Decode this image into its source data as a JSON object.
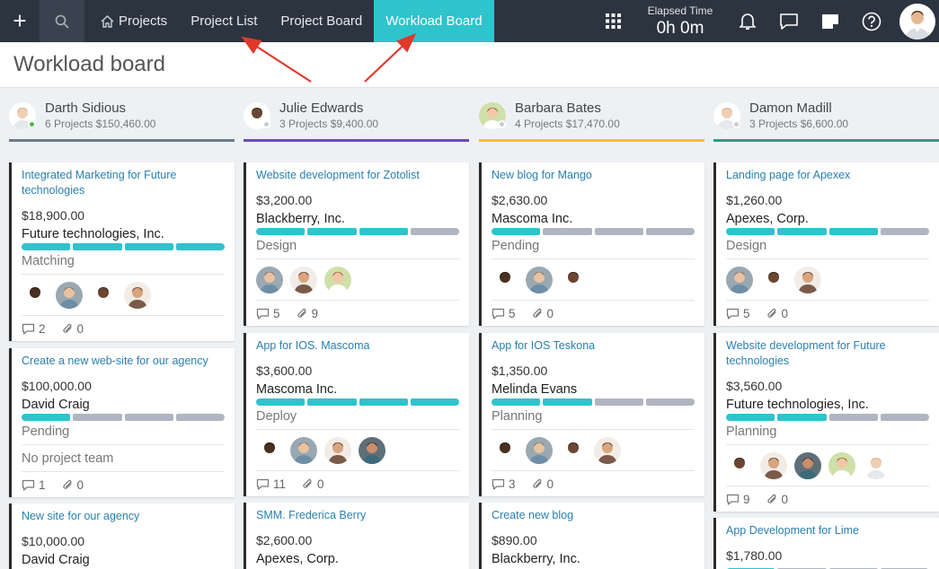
{
  "nav": {
    "items": [
      {
        "label": "Projects",
        "icon": "home-icon"
      },
      {
        "label": "Project List"
      },
      {
        "label": "Project Board"
      },
      {
        "label": "Workload Board",
        "active": true
      }
    ],
    "elapsed_label": "Elapsed Time",
    "elapsed_value": "0h 0m",
    "accent": "#2fc3cc"
  },
  "page": {
    "title": "Workload board"
  },
  "columns": [
    {
      "name": "Darth Sidious",
      "summary": "6 Projects $150,460.00",
      "line_color": "#6a7a8c",
      "status": "#48b844",
      "cards": [
        {
          "title": "Integrated Marketing for Future technologies",
          "amount": "$18,900.00",
          "client": "Future technologies, Inc.",
          "progress": 4,
          "stage": "Matching",
          "team": [
            "m-dark",
            "m-light",
            "f-dark",
            "m-tan"
          ],
          "comments": "2",
          "files": "0"
        },
        {
          "title": "Create a new web-site for our agency",
          "amount": "$100,000.00",
          "client": "David Craig",
          "progress": 1,
          "stage": "Pending",
          "team_text": "No project team",
          "comments": "1",
          "files": "0"
        },
        {
          "title": "New site for our agency",
          "amount": "$10,000.00",
          "client": "David Craig"
        }
      ]
    },
    {
      "name": "Julie Edwards",
      "summary": "3 Projects $9,400.00",
      "line_color": "#6a4bb8",
      "status": "#c9ccd1",
      "cards": [
        {
          "title": "Website development for Zotolist",
          "amount": "$3,200.00",
          "client": "Blackberry, Inc.",
          "progress": 3,
          "stage": "Design",
          "team": [
            "m-light",
            "m-tan",
            "f-red"
          ],
          "comments": "5",
          "files": "9"
        },
        {
          "title": "App for IOS. Mascoma",
          "amount": "$3,600.00",
          "client": "Mascoma Inc.",
          "progress": 4,
          "stage": "Deploy",
          "team": [
            "m-dark",
            "m-light",
            "m-tan",
            "m-beard"
          ],
          "comments": "11",
          "files": "0"
        },
        {
          "title": "SMM. Frederica Berry",
          "amount": "$2,600.00",
          "client": "Apexes, Corp."
        }
      ]
    },
    {
      "name": "Barbara Bates",
      "summary": "4 Projects $17,470.00",
      "line_color": "#f0c232",
      "status": "#c9ccd1",
      "cards": [
        {
          "title": "New blog for Mango",
          "amount": "$2,630.00",
          "client": "Mascoma Inc.",
          "progress": 1,
          "stage": "Pending",
          "team": [
            "m-dark",
            "m-light",
            "f-dark"
          ],
          "comments": "5",
          "files": "0"
        },
        {
          "title": "App for IOS Teskona",
          "amount": "$1,350.00",
          "client": "Melinda Evans",
          "progress": 2,
          "stage": "Planning",
          "team": [
            "m-dark",
            "m-light",
            "f-dark",
            "m-tan"
          ],
          "comments": "3",
          "files": "0"
        },
        {
          "title": "Create new blog",
          "amount": "$890.00",
          "client": "Blackberry, Inc."
        }
      ]
    },
    {
      "name": "Damon Madill",
      "summary": "3 Projects $6,600.00",
      "line_color": "#2a9d8a",
      "status": "#c9ccd1",
      "cards": [
        {
          "title": "Landing page for Apexex",
          "amount": "$1,260.00",
          "client": "Apexes, Corp.",
          "progress": 3,
          "stage": "Design",
          "team": [
            "m-light",
            "f-dark",
            "m-tan"
          ],
          "comments": "5",
          "files": "0"
        },
        {
          "title": "Website development for Future technologies",
          "amount": "$3,560.00",
          "client": "Future technologies, Inc.",
          "progress": 2,
          "stage": "Planning",
          "team": [
            "f-dark",
            "m-tan",
            "m-beard",
            "f-red",
            "m-white"
          ],
          "comments": "9",
          "files": "0"
        },
        {
          "title": "App Development for Lime",
          "amount": "$1,780.00",
          "progress": 1
        }
      ]
    }
  ]
}
